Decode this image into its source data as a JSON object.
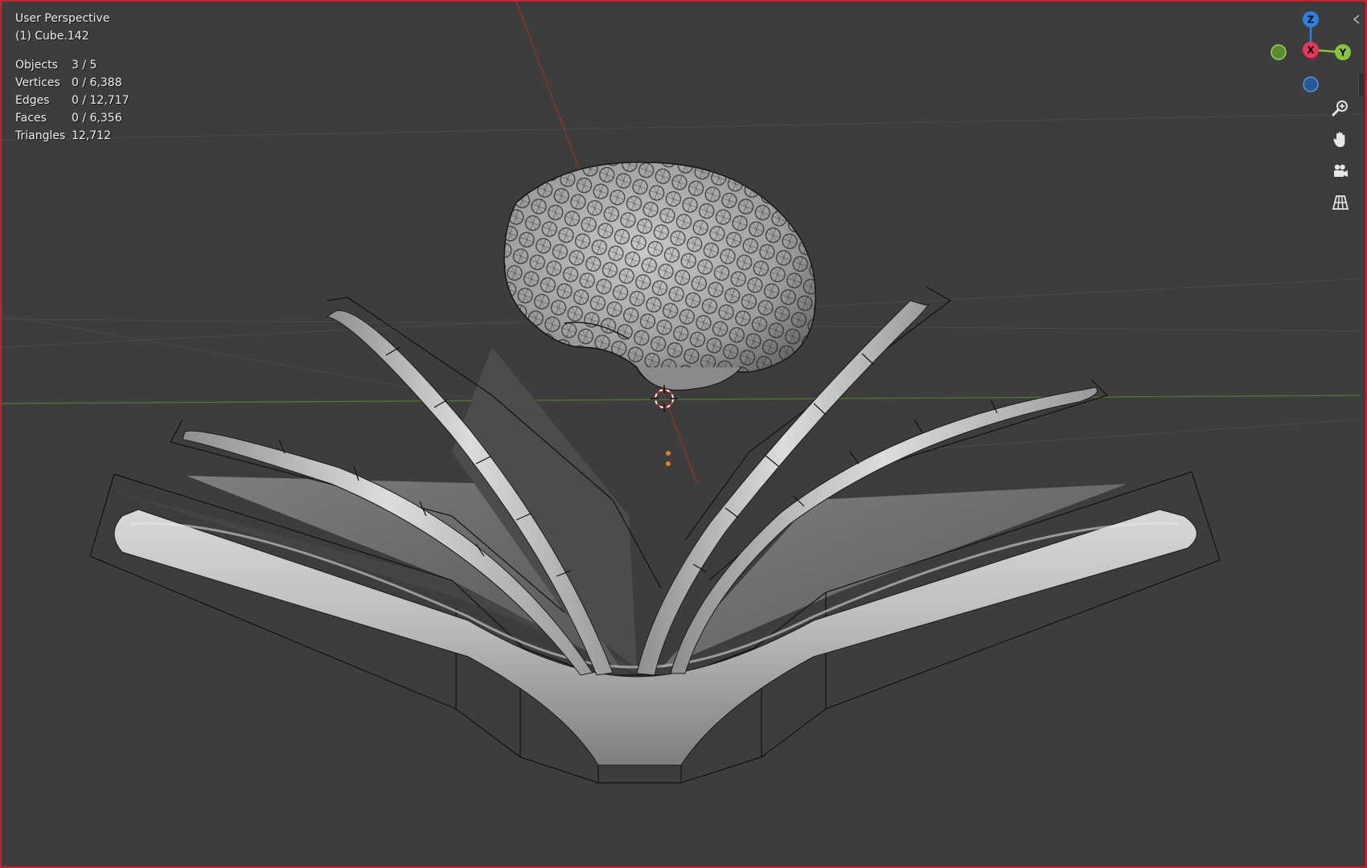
{
  "viewport": {
    "view_name": "User Perspective",
    "active_object": "(1) Cube.142",
    "stats": [
      {
        "label": "Objects",
        "value": "3 / 5"
      },
      {
        "label": "Vertices",
        "value": "0 / 6,388"
      },
      {
        "label": "Edges",
        "value": "0 / 12,717"
      },
      {
        "label": "Faces",
        "value": "0 / 6,356"
      },
      {
        "label": "Triangles",
        "value": "12,712"
      }
    ]
  },
  "gizmo": {
    "z_label": "Z",
    "x_label": "X",
    "y_label": "Y",
    "colors": {
      "x": "#e5395a",
      "y": "#8ac43e",
      "z": "#2f7fe1",
      "neg_y": "#5e8a32",
      "neg_z": "#2a5897"
    }
  },
  "nav": {
    "icons": [
      "zoom-icon",
      "hand-pan-icon",
      "camera-icon",
      "grid-perspective-icon"
    ]
  },
  "colors": {
    "background": "#3d3d3d",
    "border": "#c8222a",
    "mesh": "#bdbdbd",
    "wire": "#111111",
    "x_axis": "#9b3030",
    "y_axis": "#4e7a2e"
  }
}
